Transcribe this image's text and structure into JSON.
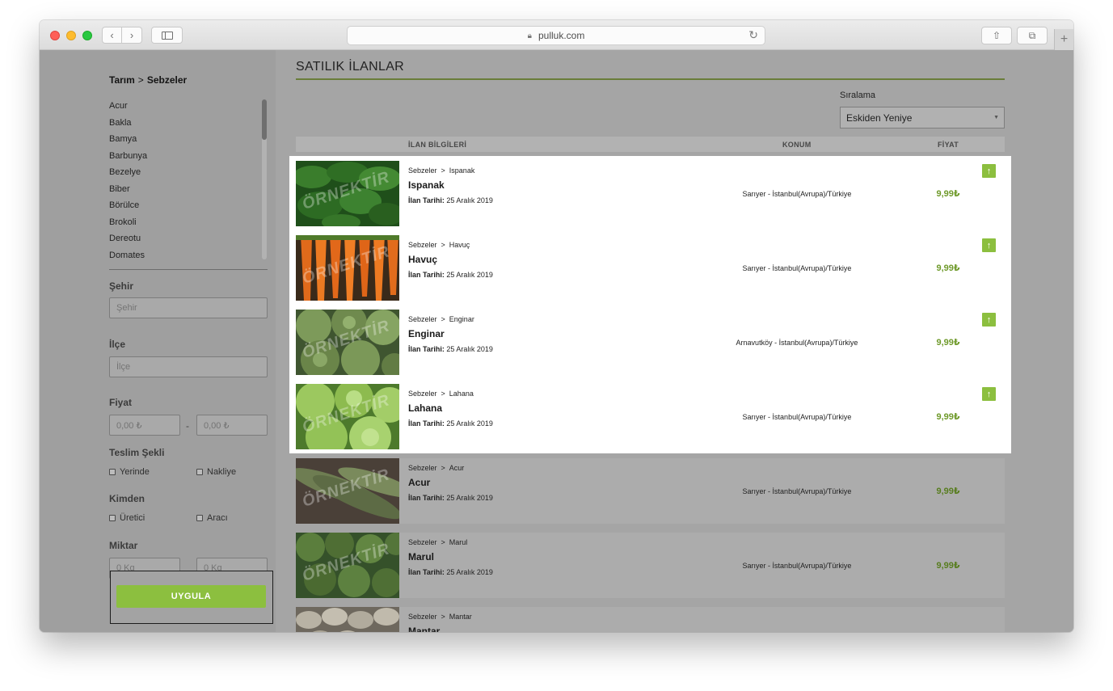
{
  "browser": {
    "url": "pulluk.com",
    "icons": {
      "lock": "lock-icon",
      "reload": "reload-icon",
      "share": "share-icon",
      "tabs": "tabs-icon"
    }
  },
  "sidebar": {
    "breadcrumb": {
      "root": "Tarım",
      "separator": ">",
      "current": "Sebzeler"
    },
    "categories": [
      "Acur",
      "Bakla",
      "Bamya",
      "Barbunya",
      "Bezelye",
      "Biber",
      "Börülce",
      "Brokoli",
      "Dereotu",
      "Domates"
    ],
    "city": {
      "label": "Şehir",
      "placeholder": "Şehir"
    },
    "district": {
      "label": "İlçe",
      "placeholder": "İlçe"
    },
    "price": {
      "label": "Fiyat",
      "min_placeholder": "0,00 ₺",
      "max_placeholder": "0,00 ₺",
      "separator": "-"
    },
    "delivery": {
      "label": "Teslim Şekli",
      "options": [
        "Yerinde",
        "Nakliye"
      ]
    },
    "from": {
      "label": "Kimden",
      "options": [
        "Üretici",
        "Aracı"
      ]
    },
    "quantity": {
      "label": "Miktar",
      "min_placeholder": "0 Kg",
      "max_placeholder": "0 Kg"
    },
    "apply_label": "UYGULA"
  },
  "main": {
    "title": "SATILIK İLANLAR",
    "sort": {
      "label": "Sıralama",
      "selected": "Eskiden Yeniye"
    },
    "columns": {
      "info": "İLAN BİLGİLERİ",
      "location": "KONUM",
      "price": "FİYAT"
    },
    "date_label": "İlan Tarihi:",
    "watermark": "ÖRNEKTİR",
    "listings": [
      {
        "category": "Sebzeler",
        "sub": "Ispanak",
        "title": "Ispanak",
        "date": "25 Aralık 2019",
        "location": "Sarıyer - İstanbul(Avrupa)/Türkiye",
        "price": "9,99₺",
        "highlight": true,
        "image": "spinach-photo",
        "color": "#2f6e24"
      },
      {
        "category": "Sebzeler",
        "sub": "Havuç",
        "title": "Havuç",
        "date": "25 Aralık 2019",
        "location": "Sarıyer - İstanbul(Avrupa)/Türkiye",
        "price": "9,99₺",
        "highlight": true,
        "image": "carrot-photo",
        "color": "#e06a1b"
      },
      {
        "category": "Sebzeler",
        "sub": "Enginar",
        "title": "Enginar",
        "date": "25 Aralık 2019",
        "location": "Arnavutköy - İstanbul(Avrupa)/Türkiye",
        "price": "9,99₺",
        "highlight": true,
        "image": "artichoke-photo",
        "color": "#6f8a4e"
      },
      {
        "category": "Sebzeler",
        "sub": "Lahana",
        "title": "Lahana",
        "date": "25 Aralık 2019",
        "location": "Sarıyer - İstanbul(Avrupa)/Türkiye",
        "price": "9,99₺",
        "highlight": true,
        "image": "cabbage-photo",
        "color": "#8dbb4f"
      },
      {
        "category": "Sebzeler",
        "sub": "Acur",
        "title": "Acur",
        "date": "25 Aralık 2019",
        "location": "Sarıyer - İstanbul(Avrupa)/Türkiye",
        "price": "9,99₺",
        "highlight": false,
        "image": "acur-photo",
        "color": "#5d6b45"
      },
      {
        "category": "Sebzeler",
        "sub": "Marul",
        "title": "Marul",
        "date": "25 Aralık 2019",
        "location": "Sarıyer - İstanbul(Avrupa)/Türkiye",
        "price": "9,99₺",
        "highlight": false,
        "image": "lettuce-photo",
        "color": "#4f6e34"
      },
      {
        "category": "Sebzeler",
        "sub": "Mantar",
        "title": "Mantar",
        "date": "",
        "location": "",
        "price": "",
        "highlight": false,
        "image": "mushroom-photo",
        "color": "#8f8a7e"
      }
    ]
  },
  "colors": {
    "accent": "#8cbf3f",
    "price": "#6f9a2b",
    "overlay": "#a3a3a3"
  }
}
